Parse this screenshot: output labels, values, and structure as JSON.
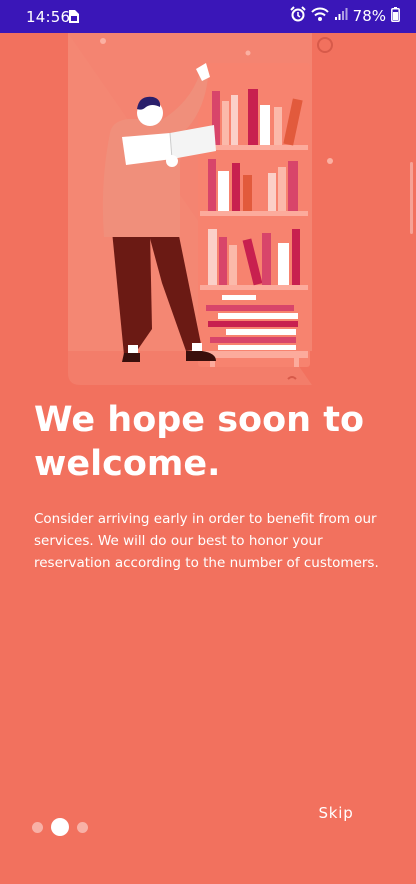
{
  "status_bar": {
    "time": "14:56",
    "battery": "78%",
    "icons": [
      "sim-card-icon",
      "alarm-icon",
      "wifi-icon",
      "signal-icon",
      "battery-icon"
    ]
  },
  "onboarding": {
    "title": "We hope soon to welcome.",
    "description": "Consider arriving early in order to benefit from our services. We will do our best to honor your reservation according to the number of customers.",
    "skip_label": "Skip",
    "page_count": 3,
    "current_page": 2
  },
  "colors": {
    "background": "#f2715e",
    "status_bar": "#3a16b8",
    "text": "#ffffff"
  }
}
